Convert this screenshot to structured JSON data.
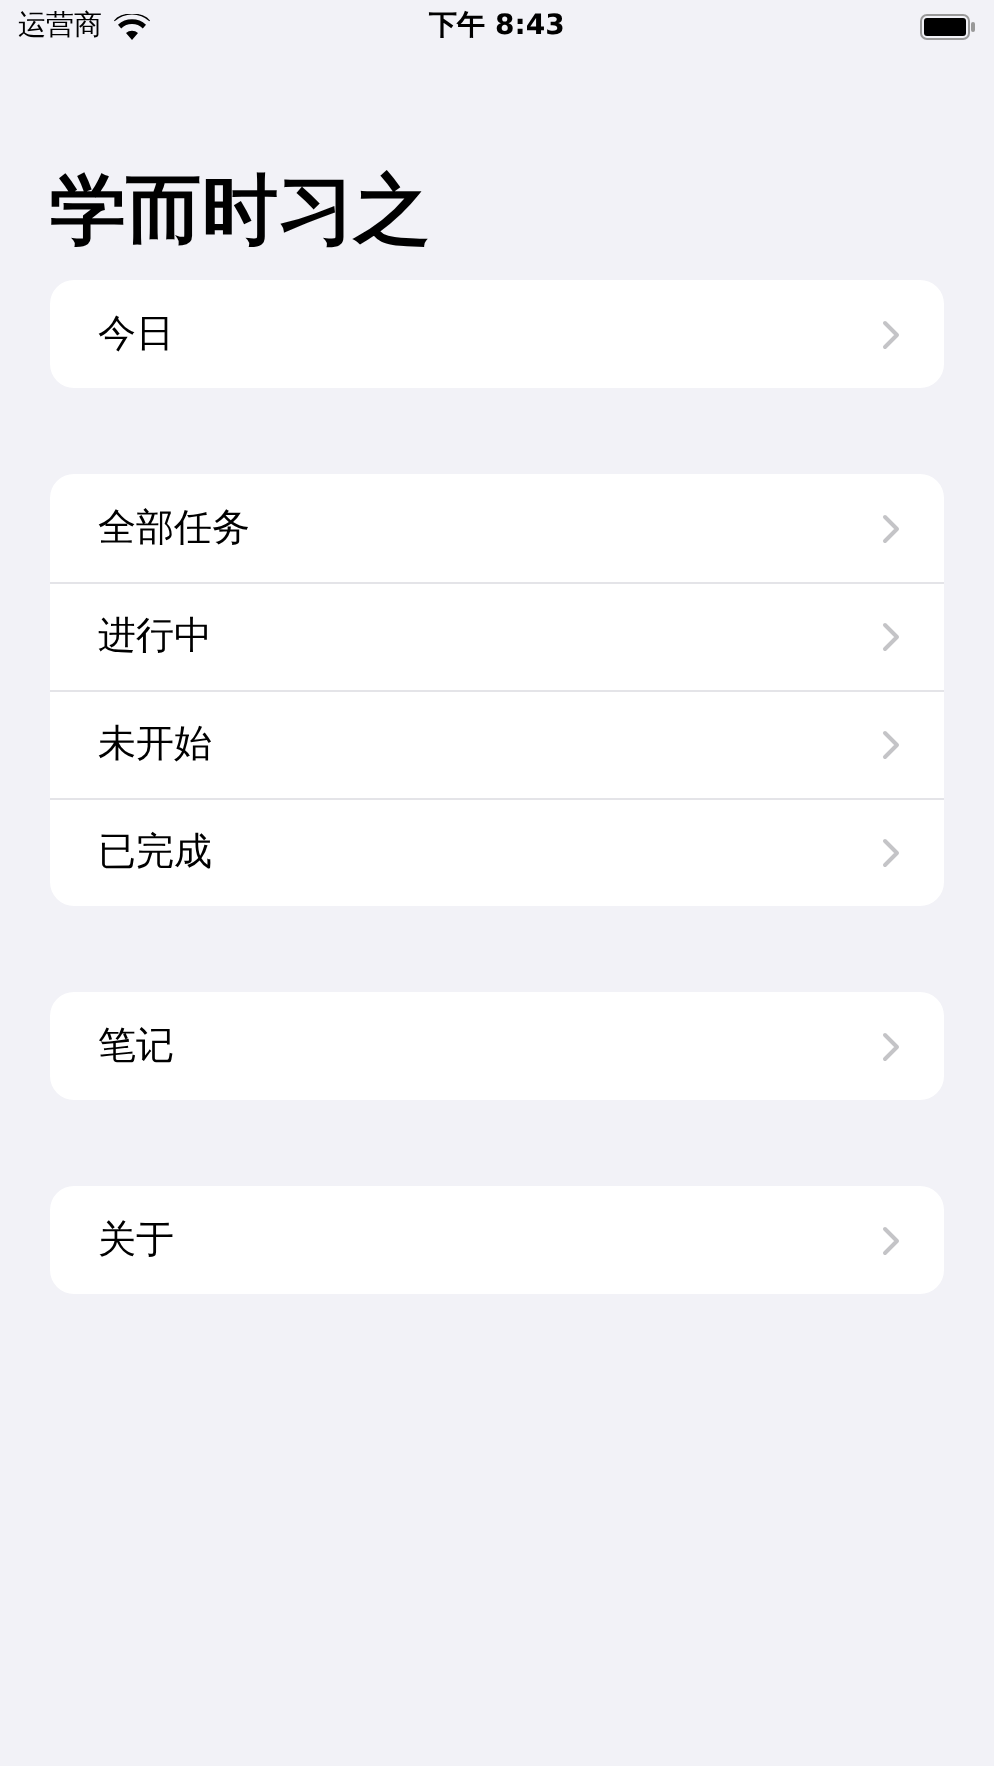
{
  "status_bar": {
    "carrier": "运营商",
    "time": "下午 8:43"
  },
  "title": "学而时习之",
  "groups": [
    {
      "items": [
        {
          "label": "今日"
        }
      ]
    },
    {
      "items": [
        {
          "label": "全部任务"
        },
        {
          "label": "进行中"
        },
        {
          "label": "未开始"
        },
        {
          "label": "已完成"
        }
      ]
    },
    {
      "items": [
        {
          "label": "笔记"
        }
      ]
    },
    {
      "items": [
        {
          "label": "关于"
        }
      ]
    }
  ]
}
